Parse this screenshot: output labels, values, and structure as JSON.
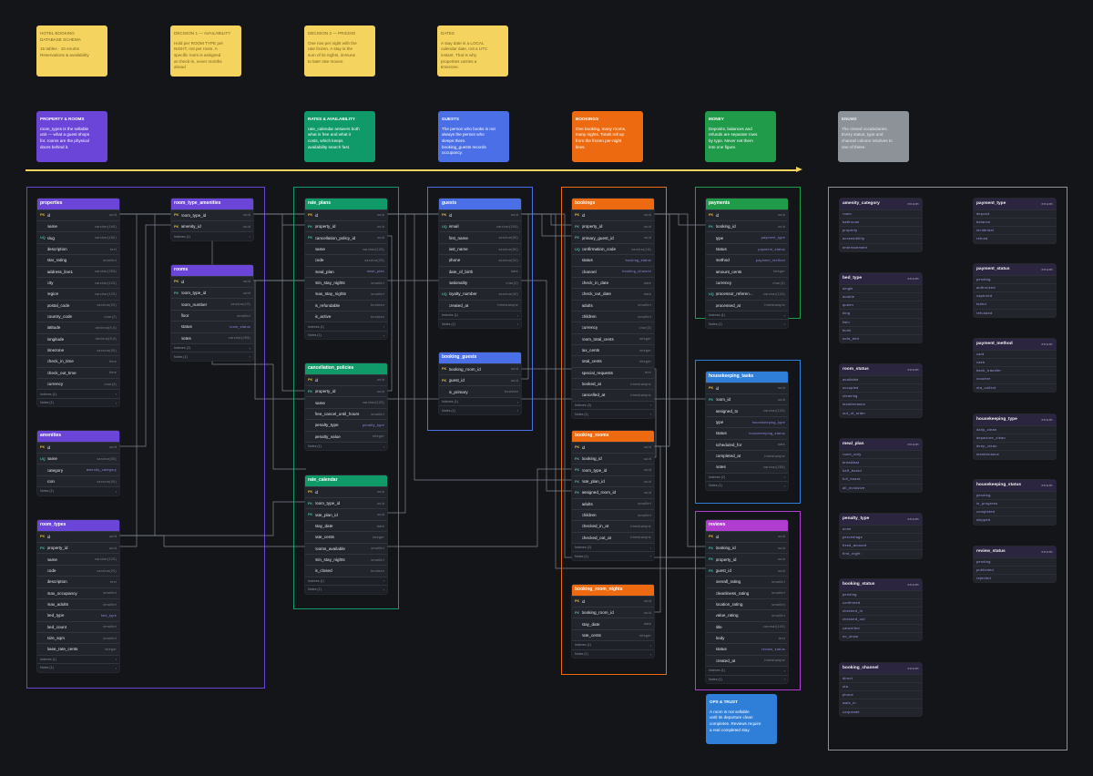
{
  "notes": [
    {
      "id": "overview",
      "title": "HOTEL BOOKING\nDATABASE SCHEMA",
      "body": "15 tables · 10 enums\nReservations & availability"
    },
    {
      "id": "decision1",
      "title": "DECISION 1 — AVAILABILITY",
      "body": "Hold per ROOM TYPE per\nNIGHT, not per room. A\nspecific room is assigned\nat check-in, never months\nahead"
    },
    {
      "id": "decision2",
      "title": "DECISION 2 — PRICING",
      "body": "One row per night with the\nrate frozen. A stay is the\nsum of its nights, immune\nto later rate moves."
    },
    {
      "id": "dates",
      "title": "DATES",
      "body": "A stay date is a LOCAL\ncalendar date, not a UTC\ninstant. That is why\nproperties carries a\ntimezone."
    }
  ],
  "section_headers": [
    {
      "id": "property",
      "title": "PROPERTY & ROOMS",
      "body": "room_types is the sellable\nunit — what a guest shops\nfor. rooms are the physical\ndoors behind it.",
      "color": "#6b45d8"
    },
    {
      "id": "rates",
      "title": "RATES & AVAILABILITY",
      "body": "rate_calendar answers both\nwhat is free and what it\ncosts, which keeps\navailability search fast.",
      "color": "#109a69"
    },
    {
      "id": "guests",
      "title": "GUESTS",
      "body": "The person who books is not\nalways the person who\nsleeps there.\nbooking_guests records\noccupancy.",
      "color": "#4b6fe6"
    },
    {
      "id": "bookings",
      "title": "BOOKINGS",
      "body": "One booking, many rooms,\nmany nights. Totals roll up\nfrom the frozen per-night\nlines.",
      "color": "#ee6a10"
    },
    {
      "id": "money",
      "title": "MONEY",
      "body": "Deposits, balances and\nrefunds are separate rows\nby type. Never net them\ninto one figure.",
      "color": "#1f9b4a"
    },
    {
      "id": "enums",
      "title": "ENUMS",
      "body": "The closed vocabularies.\nEvery status, type and\nchannel column resolves to\none of these.",
      "color": "#8d9299"
    }
  ],
  "tables": {
    "properties": {
      "title": "properties",
      "color": "#6b45d8",
      "rows": [
        {
          "k": "PK",
          "n": "id",
          "t": "uuid"
        },
        {
          "k": "",
          "n": "name",
          "t": "varchar(160)"
        },
        {
          "k": "UQ",
          "n": "slug",
          "t": "varchar(160)"
        },
        {
          "k": "",
          "n": "description",
          "t": "text"
        },
        {
          "k": "",
          "n": "star_rating",
          "t": "smallint"
        },
        {
          "k": "",
          "n": "address_line1",
          "t": "varchar(255)"
        },
        {
          "k": "",
          "n": "city",
          "t": "varchar(120)"
        },
        {
          "k": "",
          "n": "region",
          "t": "varchar(120)"
        },
        {
          "k": "",
          "n": "postal_code",
          "t": "varchar(20)"
        },
        {
          "k": "",
          "n": "country_code",
          "t": "char(2)"
        },
        {
          "k": "",
          "n": "latitude",
          "t": "decimal(9,6)"
        },
        {
          "k": "",
          "n": "longitude",
          "t": "decimal(9,6)"
        },
        {
          "k": "",
          "n": "timezone",
          "t": "varchar(40)"
        },
        {
          "k": "",
          "n": "check_in_time",
          "t": "time"
        },
        {
          "k": "",
          "n": "check_out_time",
          "t": "time"
        },
        {
          "k": "",
          "n": "currency",
          "t": "char(3)"
        }
      ],
      "footers": [
        "Indexes (1)",
        "Notes (1)"
      ]
    },
    "room_type_amenities": {
      "title": "room_type_amenities",
      "color": "#6b45d8",
      "rows": [
        {
          "k": "PK",
          "n": "room_type_id",
          "t": "uuid"
        },
        {
          "k": "PK",
          "n": "amenity_id",
          "t": "uuid"
        }
      ],
      "footers": [
        "Indexes (1)"
      ]
    },
    "rooms": {
      "title": "rooms",
      "color": "#6b45d8",
      "rows": [
        {
          "k": "PK",
          "n": "id",
          "t": "uuid"
        },
        {
          "k": "FK",
          "n": "room_type_id",
          "t": "uuid"
        },
        {
          "k": "",
          "n": "room_number",
          "t": "varchar(10)"
        },
        {
          "k": "",
          "n": "floor",
          "t": "smallint"
        },
        {
          "k": "",
          "n": "status",
          "t": "room_status",
          "u": true
        },
        {
          "k": "",
          "n": "notes",
          "t": "varchar(255)"
        }
      ],
      "footers": [
        "Indexes (2)",
        "Notes (1)"
      ]
    },
    "amenities": {
      "title": "amenities",
      "color": "#6b45d8",
      "rows": [
        {
          "k": "PK",
          "n": "id",
          "t": "uuid"
        },
        {
          "k": "UQ",
          "n": "name",
          "t": "varchar(80)"
        },
        {
          "k": "",
          "n": "category",
          "t": "amenity_category",
          "u": true
        },
        {
          "k": "",
          "n": "icon",
          "t": "varchar(40)"
        }
      ],
      "footers": [
        "Notes (1)"
      ]
    },
    "room_types": {
      "title": "room_types",
      "color": "#6b45d8",
      "rows": [
        {
          "k": "PK",
          "n": "id",
          "t": "uuid"
        },
        {
          "k": "FK",
          "n": "property_id",
          "t": "uuid"
        },
        {
          "k": "",
          "n": "name",
          "t": "varchar(120)"
        },
        {
          "k": "",
          "n": "code",
          "t": "varchar(20)"
        },
        {
          "k": "",
          "n": "description",
          "t": "text"
        },
        {
          "k": "",
          "n": "max_occupancy",
          "t": "smallint"
        },
        {
          "k": "",
          "n": "max_adults",
          "t": "smallint"
        },
        {
          "k": "",
          "n": "bed_type",
          "t": "bed_type",
          "u": true
        },
        {
          "k": "",
          "n": "bed_count",
          "t": "smallint"
        },
        {
          "k": "",
          "n": "size_sqm",
          "t": "smallint"
        },
        {
          "k": "",
          "n": "base_rate_cents",
          "t": "integer"
        }
      ],
      "footers": [
        "Indexes (1)",
        "Notes (1)"
      ]
    },
    "rate_plans": {
      "title": "rate_plans",
      "color": "#109a69",
      "rows": [
        {
          "k": "PK",
          "n": "id",
          "t": "uuid"
        },
        {
          "k": "FK",
          "n": "property_id",
          "t": "uuid"
        },
        {
          "k": "FK",
          "n": "cancellation_policy_id",
          "t": "uuid"
        },
        {
          "k": "",
          "n": "name",
          "t": "varchar(120)"
        },
        {
          "k": "",
          "n": "code",
          "t": "varchar(20)"
        },
        {
          "k": "",
          "n": "meal_plan",
          "t": "meal_plan",
          "u": true
        },
        {
          "k": "",
          "n": "min_stay_nights",
          "t": "smallint"
        },
        {
          "k": "",
          "n": "max_stay_nights",
          "t": "smallint"
        },
        {
          "k": "",
          "n": "is_refundable",
          "t": "boolean"
        },
        {
          "k": "",
          "n": "is_active",
          "t": "boolean"
        }
      ],
      "footers": [
        "Indexes (1)",
        "Notes (1)"
      ]
    },
    "cancellation_policies": {
      "title": "cancellation_policies",
      "color": "#109a69",
      "rows": [
        {
          "k": "PK",
          "n": "id",
          "t": "uuid"
        },
        {
          "k": "FK",
          "n": "property_id",
          "t": "uuid"
        },
        {
          "k": "",
          "n": "name",
          "t": "varchar(120)"
        },
        {
          "k": "",
          "n": "free_cancel_until_hours",
          "t": "smallint"
        },
        {
          "k": "",
          "n": "penalty_type",
          "t": "penalty_type",
          "u": true
        },
        {
          "k": "",
          "n": "penalty_value",
          "t": "integer"
        }
      ],
      "footers": [
        "Notes (1)"
      ]
    },
    "rate_calendar": {
      "title": "rate_calendar",
      "color": "#109a69",
      "rows": [
        {
          "k": "PK",
          "n": "id",
          "t": "uuid"
        },
        {
          "k": "FK",
          "n": "room_type_id",
          "t": "uuid"
        },
        {
          "k": "FK",
          "n": "rate_plan_id",
          "t": "uuid"
        },
        {
          "k": "",
          "n": "stay_date",
          "t": "date"
        },
        {
          "k": "",
          "n": "rate_cents",
          "t": "integer"
        },
        {
          "k": "",
          "n": "rooms_available",
          "t": "smallint"
        },
        {
          "k": "",
          "n": "min_stay_nights",
          "t": "smallint"
        },
        {
          "k": "",
          "n": "is_closed",
          "t": "boolean"
        }
      ],
      "footers": [
        "Indexes (1)",
        "Notes (1)"
      ]
    },
    "guests": {
      "title": "guests",
      "color": "#4b6fe6",
      "rows": [
        {
          "k": "PK",
          "n": "id",
          "t": "uuid"
        },
        {
          "k": "UQ",
          "n": "email",
          "t": "varchar(255)"
        },
        {
          "k": "",
          "n": "first_name",
          "t": "varchar(80)"
        },
        {
          "k": "",
          "n": "last_name",
          "t": "varchar(80)"
        },
        {
          "k": "",
          "n": "phone",
          "t": "varchar(32)"
        },
        {
          "k": "",
          "n": "date_of_birth",
          "t": "date"
        },
        {
          "k": "",
          "n": "nationality",
          "t": "char(2)"
        },
        {
          "k": "UQ",
          "n": "loyalty_number",
          "t": "varchar(40)"
        },
        {
          "k": "",
          "n": "created_at",
          "t": "timestamptz"
        }
      ],
      "footers": [
        "Indexes (1)",
        "Notes (1)"
      ]
    },
    "booking_guests": {
      "title": "booking_guests",
      "color": "#4b6fe6",
      "rows": [
        {
          "k": "PK",
          "n": "booking_room_id",
          "t": "uuid"
        },
        {
          "k": "PK",
          "n": "guest_id",
          "t": "uuid"
        },
        {
          "k": "",
          "n": "is_primary",
          "t": "boolean"
        }
      ],
      "footers": [
        "Indexes (1)",
        "Notes (1)"
      ]
    },
    "bookings": {
      "title": "bookings",
      "color": "#ee6a10",
      "rows": [
        {
          "k": "PK",
          "n": "id",
          "t": "uuid"
        },
        {
          "k": "FK",
          "n": "property_id",
          "t": "uuid"
        },
        {
          "k": "FK",
          "n": "primary_guest_id",
          "t": "uuid"
        },
        {
          "k": "UQ",
          "n": "confirmation_code",
          "t": "varchar(16)"
        },
        {
          "k": "",
          "n": "status",
          "t": "booking_status",
          "u": true
        },
        {
          "k": "",
          "n": "channel",
          "t": "booking_channel",
          "u": true
        },
        {
          "k": "",
          "n": "check_in_date",
          "t": "date"
        },
        {
          "k": "",
          "n": "check_out_date",
          "t": "date"
        },
        {
          "k": "",
          "n": "adults",
          "t": "smallint"
        },
        {
          "k": "",
          "n": "children",
          "t": "smallint"
        },
        {
          "k": "",
          "n": "currency",
          "t": "char(3)"
        },
        {
          "k": "",
          "n": "room_total_cents",
          "t": "integer"
        },
        {
          "k": "",
          "n": "tax_cents",
          "t": "integer"
        },
        {
          "k": "",
          "n": "total_cents",
          "t": "integer"
        },
        {
          "k": "",
          "n": "special_requests",
          "t": "text"
        },
        {
          "k": "",
          "n": "booked_at",
          "t": "timestamptz"
        },
        {
          "k": "",
          "n": "cancelled_at",
          "t": "timestamptz"
        }
      ],
      "footers": [
        "Indexes (3)",
        "Notes (1)"
      ]
    },
    "booking_rooms": {
      "title": "booking_rooms",
      "color": "#ee6a10",
      "rows": [
        {
          "k": "PK",
          "n": "id",
          "t": "uuid"
        },
        {
          "k": "FK",
          "n": "booking_id",
          "t": "uuid"
        },
        {
          "k": "FK",
          "n": "room_type_id",
          "t": "uuid"
        },
        {
          "k": "FK",
          "n": "rate_plan_id",
          "t": "uuid"
        },
        {
          "k": "FK",
          "n": "assigned_room_id",
          "t": "uuid"
        },
        {
          "k": "",
          "n": "adults",
          "t": "smallint"
        },
        {
          "k": "",
          "n": "children",
          "t": "smallint"
        },
        {
          "k": "",
          "n": "checked_in_at",
          "t": "timestamptz"
        },
        {
          "k": "",
          "n": "checked_out_at",
          "t": "timestamptz"
        }
      ],
      "footers": [
        "Indexes (2)",
        "Notes (1)"
      ]
    },
    "booking_room_nights": {
      "title": "booking_room_nights",
      "color": "#ee6a10",
      "rows": [
        {
          "k": "PK",
          "n": "id",
          "t": "uuid"
        },
        {
          "k": "FK",
          "n": "booking_room_id",
          "t": "uuid"
        },
        {
          "k": "",
          "n": "stay_date",
          "t": "date"
        },
        {
          "k": "",
          "n": "rate_cents",
          "t": "integer"
        }
      ],
      "footers": [
        "Indexes (1)",
        "Notes (1)"
      ]
    },
    "payments": {
      "title": "payments",
      "color": "#1f9b4a",
      "rows": [
        {
          "k": "PK",
          "n": "id",
          "t": "uuid"
        },
        {
          "k": "FK",
          "n": "booking_id",
          "t": "uuid"
        },
        {
          "k": "",
          "n": "type",
          "t": "payment_type",
          "u": true
        },
        {
          "k": "",
          "n": "status",
          "t": "payment_status",
          "u": true
        },
        {
          "k": "",
          "n": "method",
          "t": "payment_method",
          "u": true
        },
        {
          "k": "",
          "n": "amount_cents",
          "t": "integer"
        },
        {
          "k": "",
          "n": "currency",
          "t": "char(3)"
        },
        {
          "k": "UQ",
          "n": "processor_referen...",
          "t": "varchar(120)"
        },
        {
          "k": "",
          "n": "processed_at",
          "t": "timestamptz"
        }
      ],
      "footers": [
        "Indexes (1)",
        "Notes (1)"
      ]
    },
    "housekeeping_tasks": {
      "title": "housekeeping_tasks",
      "color": "#2f7fd9",
      "rows": [
        {
          "k": "PK",
          "n": "id",
          "t": "uuid"
        },
        {
          "k": "FK",
          "n": "room_id",
          "t": "uuid"
        },
        {
          "k": "",
          "n": "assigned_to",
          "t": "varchar(120)"
        },
        {
          "k": "",
          "n": "type",
          "t": "housekeeping_type",
          "u": true
        },
        {
          "k": "",
          "n": "status",
          "t": "housekeeping_status",
          "u": true
        },
        {
          "k": "",
          "n": "scheduled_for",
          "t": "date"
        },
        {
          "k": "",
          "n": "completed_at",
          "t": "timestamptz"
        },
        {
          "k": "",
          "n": "notes",
          "t": "varchar(255)"
        }
      ],
      "footers": [
        "Indexes (2)",
        "Notes (1)"
      ]
    },
    "reviews": {
      "title": "reviews",
      "color": "#b03cd0",
      "rows": [
        {
          "k": "PK",
          "n": "id",
          "t": "uuid"
        },
        {
          "k": "FK",
          "n": "booking_id",
          "t": "uuid"
        },
        {
          "k": "FK",
          "n": "property_id",
          "t": "uuid"
        },
        {
          "k": "FK",
          "n": "guest_id",
          "t": "uuid"
        },
        {
          "k": "",
          "n": "overall_rating",
          "t": "smallint"
        },
        {
          "k": "",
          "n": "cleanliness_rating",
          "t": "smallint"
        },
        {
          "k": "",
          "n": "location_rating",
          "t": "smallint"
        },
        {
          "k": "",
          "n": "value_rating",
          "t": "smallint"
        },
        {
          "k": "",
          "n": "title",
          "t": "varchar(140)"
        },
        {
          "k": "",
          "n": "body",
          "t": "text"
        },
        {
          "k": "",
          "n": "status",
          "t": "review_status",
          "u": true
        },
        {
          "k": "",
          "n": "created_at",
          "t": "timestamptz"
        }
      ],
      "footers": [
        "Indexes (1)",
        "Notes (1)"
      ]
    }
  },
  "ops_note": {
    "title": "OPS & TRUST",
    "body": "A room is not sellable\nuntil its departure clean\ncompletes. Reviews require\na real completed stay."
  },
  "enums": {
    "amenity_category": [
      "room",
      "bathroom",
      "property",
      "accessibility",
      "entertainment"
    ],
    "bed_type": [
      "single",
      "double",
      "queen",
      "king",
      "twin",
      "bunk",
      "sofa_bed"
    ],
    "room_status": [
      "available",
      "occupied",
      "cleaning",
      "maintenance",
      "out_of_order"
    ],
    "meal_plan": [
      "room_only",
      "breakfast",
      "half_board",
      "full_board",
      "all_inclusive"
    ],
    "penalty_type": [
      "none",
      "percentage",
      "fixed_amount",
      "first_night"
    ],
    "booking_status": [
      "pending",
      "confirmed",
      "checked_in",
      "checked_out",
      "cancelled",
      "no_show"
    ],
    "booking_channel": [
      "direct",
      "ota",
      "phone",
      "walk_in",
      "corporate"
    ],
    "payment_type": [
      "deposit",
      "balance",
      "incidental",
      "refund"
    ],
    "payment_status": [
      "pending",
      "authorized",
      "captured",
      "failed",
      "refunded"
    ],
    "payment_method": [
      "card",
      "cash",
      "bank_transfer",
      "voucher",
      "ota_collect"
    ],
    "housekeeping_type": [
      "daily_clean",
      "departure_clean",
      "deep_clean",
      "maintenance"
    ],
    "housekeeping_status": [
      "pending",
      "in_progress",
      "completed",
      "skipped"
    ],
    "review_status": [
      "pending",
      "published",
      "rejected"
    ]
  },
  "colors": {
    "purple": "#6b45d8",
    "green": "#109a69",
    "blue": "#4b6fe6",
    "orange": "#ee6a10",
    "money": "#1f9b4a",
    "housekeeping": "#2f7fd9",
    "reviews": "#b03cd0",
    "grey": "#8d9299",
    "yellow": "#f4d35e"
  }
}
